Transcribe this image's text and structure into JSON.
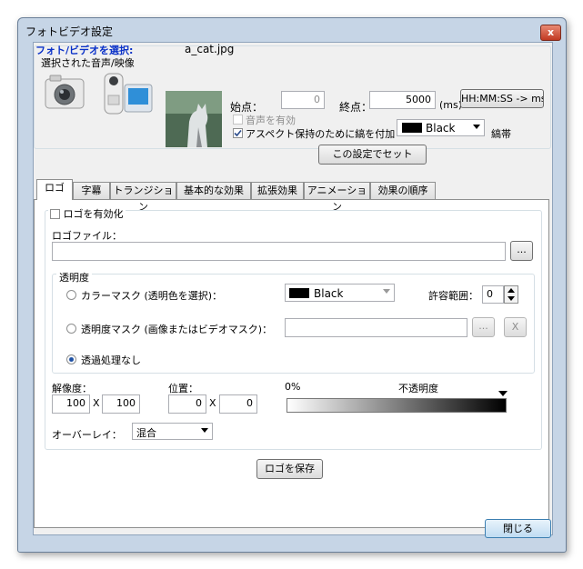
{
  "window": {
    "title": "フォトビデオ設定",
    "close_label": "x"
  },
  "media": {
    "select_label": "フォト/ビデオを選択:",
    "filename": "a_cat.jpg",
    "selected_label": "選択された音声/映像"
  },
  "timing": {
    "start_label": "始点：",
    "start_value": "0",
    "end_label": "終点：",
    "end_value": "5000",
    "unit": "(ms)",
    "format_button": "HH:MM:SS -> ms"
  },
  "options": {
    "audio_label": "音声を有効",
    "audio_checked": false,
    "aspect_label": "アスペクト保持のために縞を付加",
    "aspect_checked": true,
    "stripe_color_name": "Black",
    "stripe_color_hex": "#000000",
    "stripe_label": "縞帯",
    "set_button": "この設定でセット"
  },
  "tabs": [
    "ロゴ",
    "字幕",
    "トランジション",
    "基本的な効果",
    "拡張効果",
    "アニメーション",
    "効果の順序"
  ],
  "logo": {
    "enable_label": "ロゴを有効化",
    "file_label": "ロゴファイル：",
    "file_value": "",
    "browse_label": "...",
    "transparency_title": "透明度",
    "color_mask_label": "カラーマスク (透明色を選択)：",
    "color_mask_value": "Black",
    "tolerance_label": "許容範囲：",
    "tolerance_value": "0",
    "alpha_mask_label": "透明度マスク (画像またはビデオマスク)：",
    "alpha_browse": "...",
    "alpha_clear": "X",
    "no_transparency_label": "透過処理なし",
    "resolution_label": "解像度：",
    "res_w": "100",
    "res_h": "100",
    "position_label": "位置：",
    "pos_x": "0",
    "pos_y": "0",
    "x_sep": "X",
    "opacity_min_label": "0%",
    "opacity_max_label": "不透明度",
    "opacity_value": 1.0,
    "overlay_label": "オーバーレイ：",
    "overlay_value": "混合",
    "save_button": "ロゴを保存"
  },
  "footer": {
    "close_button": "閉じる"
  },
  "colors": {
    "accent_blue": "#0a31c8",
    "title_bg": "#c6d5e6"
  }
}
